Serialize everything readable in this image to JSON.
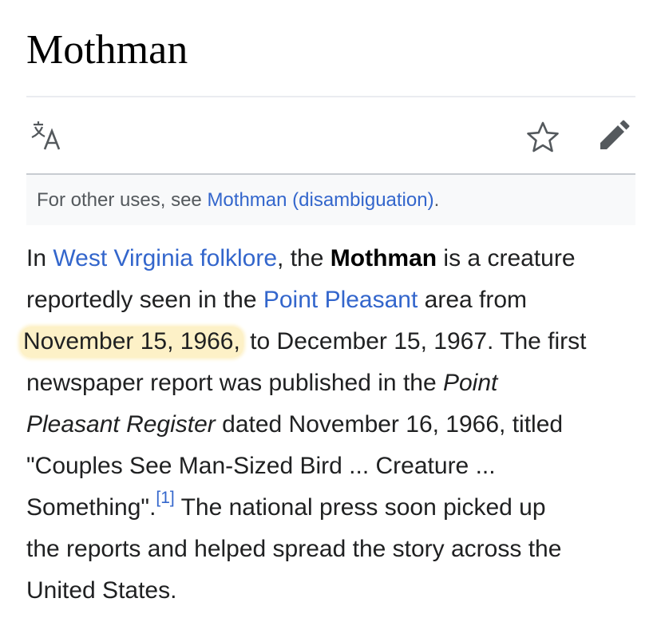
{
  "page": {
    "title": "Mothman"
  },
  "toolbar": {
    "language_icon": "translate-icon",
    "watch_icon": "star-icon",
    "edit_icon": "pencil-icon"
  },
  "hatnote": {
    "prefix": "For other uses, see ",
    "link": "Mothman (disambiguation)",
    "suffix": "."
  },
  "article": {
    "l1_a": "In ",
    "l1_link": "West Virginia folklore",
    "l1_b": ", the ",
    "l1_bold": "Mothman",
    "l1_c": " is a creature",
    "l2_a": "reportedly seen in the ",
    "l2_link": "Point Pleasant",
    "l2_b": " area from",
    "l3_highlight": "November 15, 1966,",
    "l3_b": " to December 15, 1967. The first",
    "l4_a": "newspaper report was published in the ",
    "l4_italic": "Point",
    "l5_italic": "Pleasant Register",
    "l5_b": " dated November 16, 1966, titled",
    "l6": "\"Couples See Man-Sized Bird ... Creature ...",
    "l7_a": "Something\".",
    "l7_ref": "[1]",
    "l7_b": " The national press soon picked up",
    "l8": "the reports and helped spread the story across the",
    "l9": "United States."
  },
  "colors": {
    "link": "#3366cc",
    "highlight": "#fdf1c7",
    "text": "#202122"
  }
}
